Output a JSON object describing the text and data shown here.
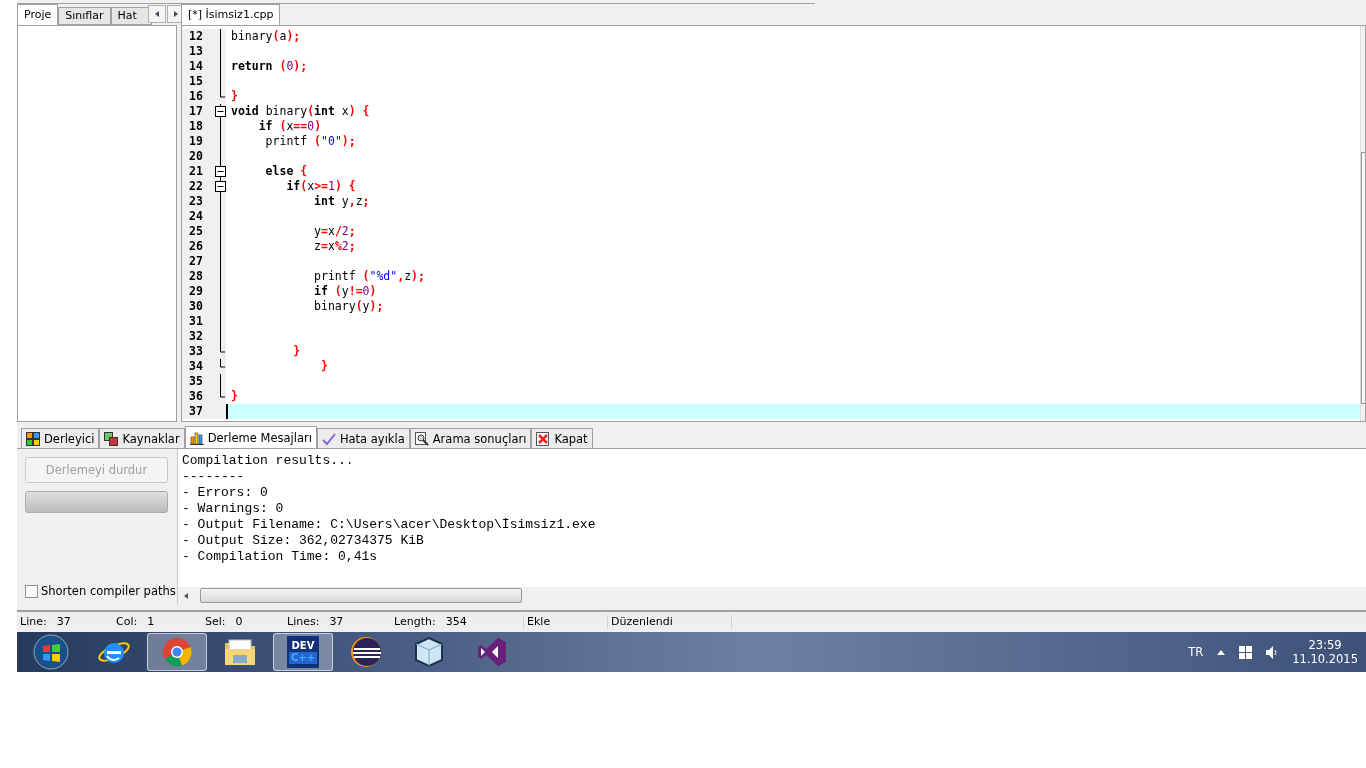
{
  "left_panel": {
    "tabs": [
      {
        "label": "Proje",
        "selected": true
      },
      {
        "label": "Sınıflar",
        "selected": false
      },
      {
        "label": "Hat",
        "selected": false
      }
    ]
  },
  "editor": {
    "tabs": [
      {
        "label": "[*] İsimsiz1.cpp",
        "selected": true
      }
    ],
    "lines": [
      {
        "number": "12",
        "kind": "line",
        "current": false,
        "tokens": [
          {
            "kind": "id",
            "text": "binary"
          },
          {
            "kind": "sym",
            "text": "("
          },
          {
            "kind": "id",
            "text": "a"
          },
          {
            "kind": "sym",
            "text": ");"
          }
        ]
      },
      {
        "number": "13",
        "kind": "line",
        "current": false
      },
      {
        "number": "14",
        "kind": "line",
        "current": false,
        "tokens": [
          {
            "kind": "kw",
            "text": "return"
          },
          {
            "kind": "sym",
            "text": " ("
          },
          {
            "kind": "num",
            "text": "0"
          },
          {
            "kind": "sym",
            "text": ");"
          }
        ]
      },
      {
        "number": "15",
        "kind": "line",
        "current": false
      },
      {
        "number": "16",
        "kind": "end",
        "current": false,
        "tokens": [
          {
            "kind": "sym",
            "text": "}"
          }
        ]
      },
      {
        "number": "17",
        "kind": "box",
        "current": false,
        "tokens": [
          {
            "kind": "kw",
            "text": "void"
          },
          {
            "kind": "id",
            "text": " binary"
          },
          {
            "kind": "sym",
            "text": "("
          },
          {
            "kind": "kw",
            "text": "int"
          },
          {
            "kind": "id",
            "text": " x"
          },
          {
            "kind": "sym",
            "text": ") {"
          }
        ]
      },
      {
        "number": "18",
        "kind": "line",
        "current": false,
        "tokens": [
          {
            "kind": "kw",
            "text": "    if"
          },
          {
            "kind": "sym",
            "text": " ("
          },
          {
            "kind": "id",
            "text": "x"
          },
          {
            "kind": "sym",
            "text": "=="
          },
          {
            "kind": "num",
            "text": "0"
          },
          {
            "kind": "sym",
            "text": ")"
          }
        ]
      },
      {
        "number": "19",
        "kind": "line",
        "current": false,
        "tokens": [
          {
            "kind": "id",
            "text": "     printf "
          },
          {
            "kind": "sym",
            "text": "("
          },
          {
            "kind": "str",
            "text": "\"0\""
          },
          {
            "kind": "sym",
            "text": ");"
          }
        ]
      },
      {
        "number": "20",
        "kind": "line",
        "current": false
      },
      {
        "number": "21",
        "kind": "box",
        "current": false,
        "tokens": [
          {
            "kind": "kw",
            "text": "     else"
          },
          {
            "kind": "sym",
            "text": " {"
          }
        ]
      },
      {
        "number": "22",
        "kind": "box",
        "current": false,
        "tokens": [
          {
            "kind": "kw",
            "text": "        if"
          },
          {
            "kind": "sym",
            "text": "("
          },
          {
            "kind": "id",
            "text": "x"
          },
          {
            "kind": "sym",
            "text": ">="
          },
          {
            "kind": "num",
            "text": "1"
          },
          {
            "kind": "sym",
            "text": ") {"
          }
        ]
      },
      {
        "number": "23",
        "kind": "line",
        "current": false,
        "tokens": [
          {
            "kind": "kw",
            "text": "            int"
          },
          {
            "kind": "id",
            "text": " y"
          },
          {
            "kind": "sym",
            "text": ","
          },
          {
            "kind": "id",
            "text": "z"
          },
          {
            "kind": "sym",
            "text": ";"
          }
        ]
      },
      {
        "number": "24",
        "kind": "line",
        "current": false
      },
      {
        "number": "25",
        "kind": "line",
        "current": false,
        "tokens": [
          {
            "kind": "id",
            "text": "            y"
          },
          {
            "kind": "sym",
            "text": "="
          },
          {
            "kind": "id",
            "text": "x"
          },
          {
            "kind": "sym",
            "text": "/"
          },
          {
            "kind": "num",
            "text": "2"
          },
          {
            "kind": "sym",
            "text": ";"
          }
        ]
      },
      {
        "number": "26",
        "kind": "line",
        "current": false,
        "tokens": [
          {
            "kind": "id",
            "text": "            z"
          },
          {
            "kind": "sym",
            "text": "="
          },
          {
            "kind": "id",
            "text": "x"
          },
          {
            "kind": "sym",
            "text": "%"
          },
          {
            "kind": "num",
            "text": "2"
          },
          {
            "kind": "sym",
            "text": ";"
          }
        ]
      },
      {
        "number": "27",
        "kind": "line",
        "current": false
      },
      {
        "number": "28",
        "kind": "line",
        "current": false,
        "tokens": [
          {
            "kind": "id",
            "text": "            printf "
          },
          {
            "kind": "sym",
            "text": "("
          },
          {
            "kind": "str",
            "text": "\"%d\""
          },
          {
            "kind": "sym",
            "text": ","
          },
          {
            "kind": "id",
            "text": "z"
          },
          {
            "kind": "sym",
            "text": ");"
          }
        ]
      },
      {
        "number": "29",
        "kind": "line",
        "current": false,
        "tokens": [
          {
            "kind": "kw",
            "text": "            if"
          },
          {
            "kind": "sym",
            "text": " ("
          },
          {
            "kind": "id",
            "text": "y"
          },
          {
            "kind": "sym",
            "text": "!="
          },
          {
            "kind": "num",
            "text": "0"
          },
          {
            "kind": "sym",
            "text": ")"
          }
        ]
      },
      {
        "number": "30",
        "kind": "line",
        "current": false,
        "tokens": [
          {
            "kind": "id",
            "text": "            binary"
          },
          {
            "kind": "sym",
            "text": "("
          },
          {
            "kind": "id",
            "text": "y"
          },
          {
            "kind": "sym",
            "text": ");"
          }
        ]
      },
      {
        "number": "31",
        "kind": "line",
        "current": false
      },
      {
        "number": "32",
        "kind": "line",
        "current": false
      },
      {
        "number": "33",
        "kind": "end",
        "current": false,
        "tokens": [
          {
            "kind": "sym",
            "text": "         }"
          }
        ]
      },
      {
        "number": "34",
        "kind": "end",
        "current": false,
        "tokens": [
          {
            "kind": "sym",
            "text": "             }"
          }
        ]
      },
      {
        "number": "35",
        "kind": "line",
        "current": false
      },
      {
        "number": "36",
        "kind": "end",
        "current": false,
        "tokens": [
          {
            "kind": "sym",
            "text": "}"
          }
        ]
      },
      {
        "number": "37",
        "kind": "none",
        "current": true
      }
    ]
  },
  "bottom_panel": {
    "tabs": [
      {
        "label": "Derleyici",
        "kind": "grid",
        "selected": false
      },
      {
        "label": "Kaynaklar",
        "kind": "windows",
        "selected": false
      },
      {
        "label": "Derleme Mesajları",
        "kind": "chart",
        "selected": true
      },
      {
        "label": "Hata ayıkla",
        "kind": "check",
        "selected": false
      },
      {
        "label": "Arama sonuçları",
        "kind": "search",
        "selected": false
      },
      {
        "label": "Kapat",
        "kind": "close",
        "selected": false
      }
    ],
    "stop_button": {
      "label": "Derlemeyi durdur",
      "disabled": true
    },
    "progress": {
      "level": 0
    },
    "shorten_paths": {
      "label": "Shorten compiler paths",
      "checked": false
    },
    "output": [
      "Compilation results...",
      "--------",
      "- Errors: 0",
      "- Warnings: 0",
      "- Output Filename: C:\\Users\\acer\\Desktop\\İsimsiz1.exe",
      "- Output Size: 362,02734375 KiB",
      "- Compilation Time: 0,41s"
    ]
  },
  "status_bar": [
    {
      "label": "Line:",
      "value": "37"
    },
    {
      "label": "Col:",
      "value": "1"
    },
    {
      "label": "Sel:",
      "value": "0"
    },
    {
      "label": "Lines:",
      "value": "37"
    },
    {
      "label": "Length:",
      "value": "354"
    },
    {
      "value": "Ekle"
    },
    {
      "value": "Düzenlendi"
    }
  ],
  "taskbar": {
    "apps": [
      {
        "kind": "start",
        "selected": false
      },
      {
        "kind": "ie",
        "selected": false
      },
      {
        "kind": "chrome",
        "selected": true
      },
      {
        "kind": "folder",
        "selected": false
      },
      {
        "kind": "devcpp",
        "selected": true,
        "logo_lines": [
          "DEV",
          "C++"
        ]
      },
      {
        "kind": "eclipse",
        "selected": false
      },
      {
        "kind": "cube",
        "selected": false
      },
      {
        "kind": "vs",
        "selected": false
      }
    ],
    "language": "TR",
    "time": "23:59",
    "date": "11.10.2015"
  }
}
